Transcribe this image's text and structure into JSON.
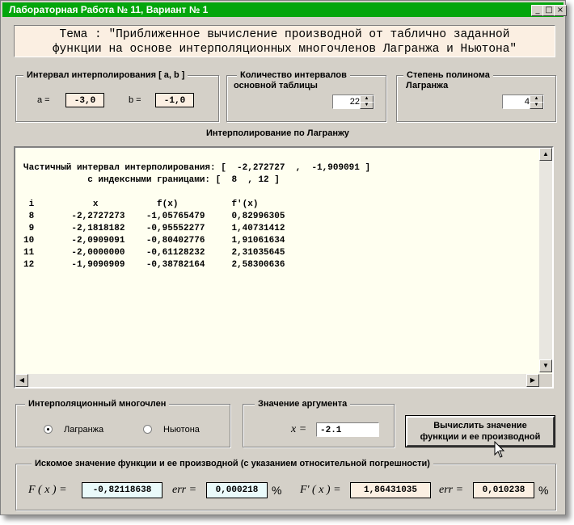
{
  "window": {
    "title": "Лабораторная Работа № 11,  Вариант № 1",
    "buttons": {
      "minimize": "_",
      "maximize": "□",
      "close": "×"
    }
  },
  "topic": {
    "line1": "Тема : \"Приближенное вычисление производной от таблично заданной",
    "line2": "функции на основе интерполяционных многочленов Лагранжа и Ньютона\""
  },
  "interval_group": {
    "title": "Интервал интерполирования  [ a, b ]",
    "a_label": "a =",
    "a_value": "-3,0",
    "b_label": "b =",
    "b_value": "-1,0"
  },
  "count_group": {
    "title": "Количество интервалов",
    "subtitle": "основной таблицы",
    "value": "22"
  },
  "degree_group": {
    "title": "Степень полинома",
    "subtitle": "Лагранжа",
    "value": "4"
  },
  "memo": {
    "heading": "Интерполирование по Лагранжу",
    "content": "Частичный интервал интерполирования: [  -2,272727  ,  -1,909091 ]\n            с индексными границами: [  8  , 12 ]\n\n i           x           f(x)          f'(x)\n 8       -2,2727273    -1,05765479     0,82996305\n 9       -2,1818182    -0,95552277     1,40731412\n10       -2,0909091    -0,80402776     1,91061634\n11       -2,0000000    -0,61128232     2,31035645\n12       -1,9090909    -0,38782164     2,58300636"
  },
  "poly_group": {
    "title": "Интерполяционный многочлен",
    "options": [
      {
        "label": "Лагранжа",
        "selected": true
      },
      {
        "label": "Ньютона",
        "selected": false
      }
    ]
  },
  "arg_group": {
    "title": "Значение аргумента",
    "x_label": "x =",
    "x_value": "-2.1"
  },
  "compute_button": {
    "line1": "Вычислить значение",
    "line2": "функции и ее производной"
  },
  "result_group": {
    "title": "Искомое значение функции и ее производной (с указанием относительной погрешности)",
    "f_label": "F ( x ) =",
    "f_value": "-0,82118638",
    "f_err_label": "err =",
    "f_err_value": "0,000218",
    "f_err_unit": "%",
    "df_label": "F' ( x ) =",
    "df_value": "1,86431035",
    "df_err_label": "err =",
    "df_err_value": "0,010238",
    "df_err_unit": "%"
  },
  "colors": {
    "title_bar": "#04a60c",
    "field_bg": "#fbefe2",
    "memo_bg": "#fffff0",
    "window_bg": "#d4d0c8"
  }
}
